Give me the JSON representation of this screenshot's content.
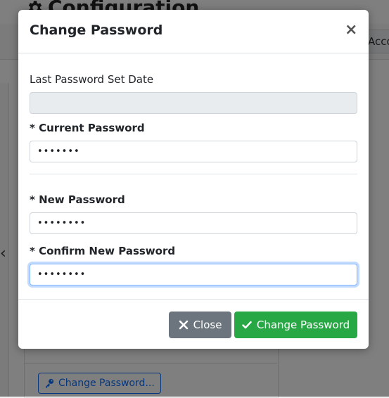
{
  "background": {
    "title": "Configuration",
    "tab_partial": "Accounts",
    "card_button_label": "Change Password..."
  },
  "modal": {
    "title": "Change Password",
    "close_icon": "×",
    "fields": {
      "last_set": {
        "label": "Last Password Set Date",
        "value": ""
      },
      "current": {
        "label": "* Current Password",
        "value": "•••••••"
      },
      "new": {
        "label": "* New Password",
        "value": "••••••••"
      },
      "confirm": {
        "label": "* Confirm New Password",
        "value": "••••••••"
      }
    },
    "buttons": {
      "close_label": "Close",
      "submit_label": "Change Password"
    }
  },
  "colors": {
    "submit": "#28a745",
    "close": "#6c757d",
    "focus": "#86b7fe",
    "link": "#0d6efd"
  }
}
